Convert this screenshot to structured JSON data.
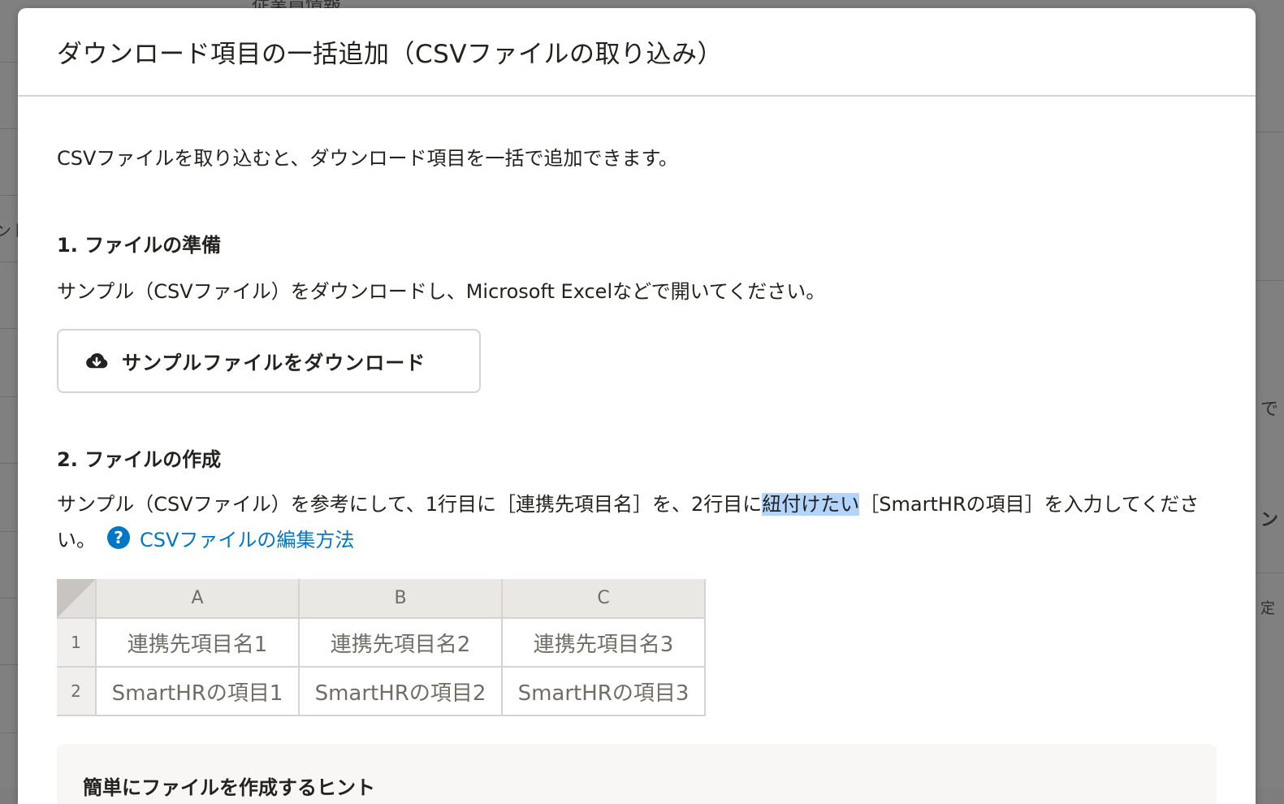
{
  "background": {
    "fragments": [
      "従業員情報",
      "ント",
      "で",
      "ン",
      "定"
    ]
  },
  "dialog": {
    "title": "ダウンロード項目の一括追加（CSVファイルの取り込み）",
    "intro": "CSVファイルを取り込むと、ダウンロード項目を一括で追加できます。",
    "step1": {
      "title": "1. ファイルの準備",
      "text": "サンプル（CSVファイル）をダウンロードし、Microsoft Excelなどで開いてください。",
      "download_button": "サンプルファイルをダウンロード",
      "download_icon": "cloud-download-icon"
    },
    "step2": {
      "title": "2. ファイルの作成",
      "text_before": "サンプル（CSVファイル）を参考にして、1行目に［連携先項目名］を、2行目に",
      "text_highlight": "紐付けたい",
      "text_after": "［SmartHRの項目］を入力してください。",
      "help_icon": "question-circle-icon",
      "help_link": "CSVファイルの編集方法"
    },
    "sheet": {
      "columns": [
        "A",
        "B",
        "C"
      ],
      "rows": [
        {
          "num": "1",
          "cells": [
            "連携先項目名1",
            "連携先項目名2",
            "連携先項目名3"
          ]
        },
        {
          "num": "2",
          "cells": [
            "SmartHRの項目1",
            "SmartHRの項目2",
            "SmartHRの項目3"
          ]
        }
      ]
    },
    "hint": {
      "title": "簡単にファイルを作成するヒント"
    }
  },
  "colors": {
    "link": "#0077c7",
    "text": "#23221e",
    "border": "#d6d3d0",
    "selection": "#b3d4fc"
  }
}
